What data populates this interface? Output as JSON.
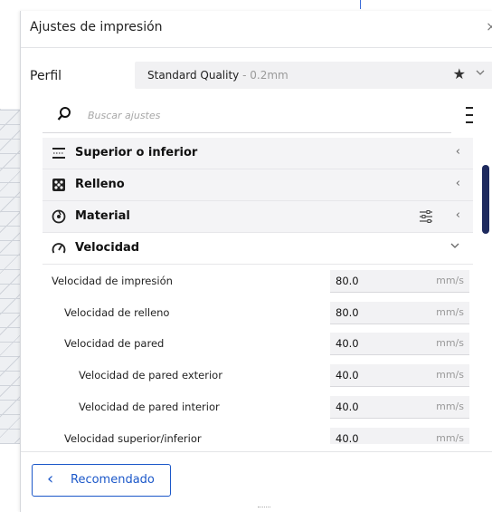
{
  "panel": {
    "title": "Ajustes de impresión",
    "close_icon": "close-icon"
  },
  "profile": {
    "label": "Perfil",
    "name": "Standard Quality",
    "suffix": " - 0.2mm"
  },
  "search": {
    "placeholder": "Buscar ajustes"
  },
  "categories": [
    {
      "label": "Superior o inferior",
      "icon": "top-bottom-icon",
      "state": "collapsed"
    },
    {
      "label": "Relleno",
      "icon": "infill-icon",
      "state": "collapsed"
    },
    {
      "label": "Material",
      "icon": "material-icon",
      "state": "collapsed"
    },
    {
      "label": "Velocidad",
      "icon": "speed-icon",
      "state": "expanded"
    }
  ],
  "settings": [
    {
      "label": "Velocidad de impresión",
      "value": "80.0",
      "unit": "mm/s",
      "indent": 0
    },
    {
      "label": "Velocidad de relleno",
      "value": "80.0",
      "unit": "mm/s",
      "indent": 1
    },
    {
      "label": "Velocidad de pared",
      "value": "40.0",
      "unit": "mm/s",
      "indent": 1
    },
    {
      "label": "Velocidad de pared exterior",
      "value": "40.0",
      "unit": "mm/s",
      "indent": 2
    },
    {
      "label": "Velocidad de pared interior",
      "value": "40.0",
      "unit": "mm/s",
      "indent": 2
    },
    {
      "label": "Velocidad superior/inferior",
      "value": "40.0",
      "unit": "mm/s",
      "indent": 1
    }
  ],
  "footer": {
    "recommended_label": "Recomendado"
  },
  "colors": {
    "accent": "#1c58c9",
    "scrollbar": "#1e2a5e"
  }
}
